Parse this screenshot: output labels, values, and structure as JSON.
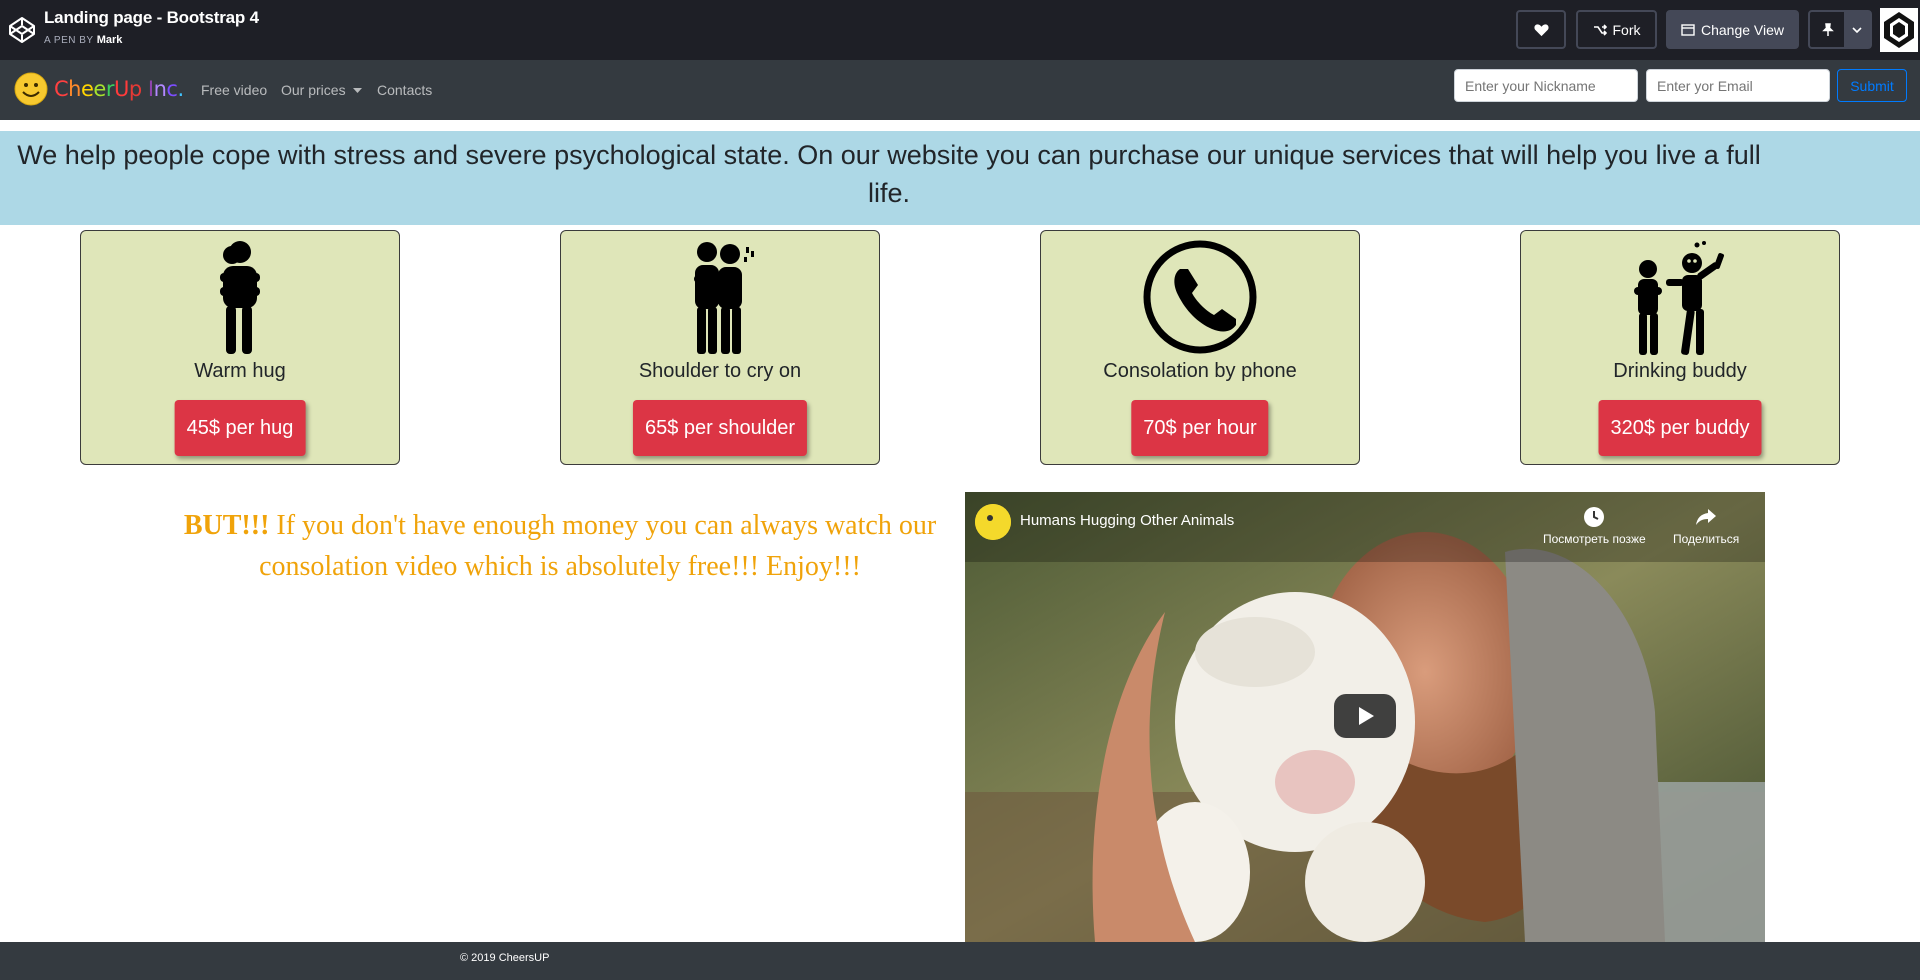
{
  "codepen": {
    "title": "Landing page - Bootstrap 4",
    "byline_prefix": "A PEN BY",
    "author": "Mark",
    "fork_label": "Fork",
    "change_view_label": "Change View"
  },
  "navbar": {
    "brand": [
      "C",
      "h",
      "e",
      "e",
      "r",
      "U",
      "p",
      " ",
      "I",
      "n",
      "c",
      "."
    ],
    "brand_colors": [
      "#ff4040",
      "#ff8a2b",
      "#ffd400",
      "#a6e22e",
      "#3ecf5a",
      "#ff3b3b",
      "#e53935",
      "#ffffff",
      "#8e44ad",
      "#b388ff",
      "#7c4dff",
      "#40c4ff"
    ],
    "links": [
      "Free video",
      "Our prices",
      "Contacts"
    ],
    "nickname_placeholder": "Enter your Nickname",
    "email_placeholder": "Enter yor Email",
    "submit_label": "Submit"
  },
  "banner": {
    "text": "We help people cope with stress and severe psychological state. On our website you can purchase our unique services that will help you live a full life."
  },
  "services": [
    {
      "label": "Warm hug",
      "price": "45$ per hug",
      "icon": "hug-icon"
    },
    {
      "label": "Shoulder to cry on",
      "price": "65$ per shoulder",
      "icon": "shoulder-icon"
    },
    {
      "label": "Consolation by phone",
      "price": "70$ per hour",
      "icon": "phone-icon"
    },
    {
      "label": "Drinking buddy",
      "price": "320$ per buddy",
      "icon": "drinking-buddy-icon"
    }
  ],
  "free_video": {
    "lead": "BUT!!!",
    "text": " If you don't have enough money you can always watch our consolation video which is absolutely free!!! Enjoy!!!"
  },
  "video": {
    "title": "Humans Hugging Other Animals",
    "watch_later": "Посмотреть позже",
    "share": "Поделиться"
  },
  "footer": {
    "text": "© 2019 CheersUP"
  },
  "colors": {
    "card_bg": "#dfe6b9",
    "price_button": "#dc3545",
    "banner_bg": "#add8e6",
    "promo_text": "#f0a30a"
  }
}
